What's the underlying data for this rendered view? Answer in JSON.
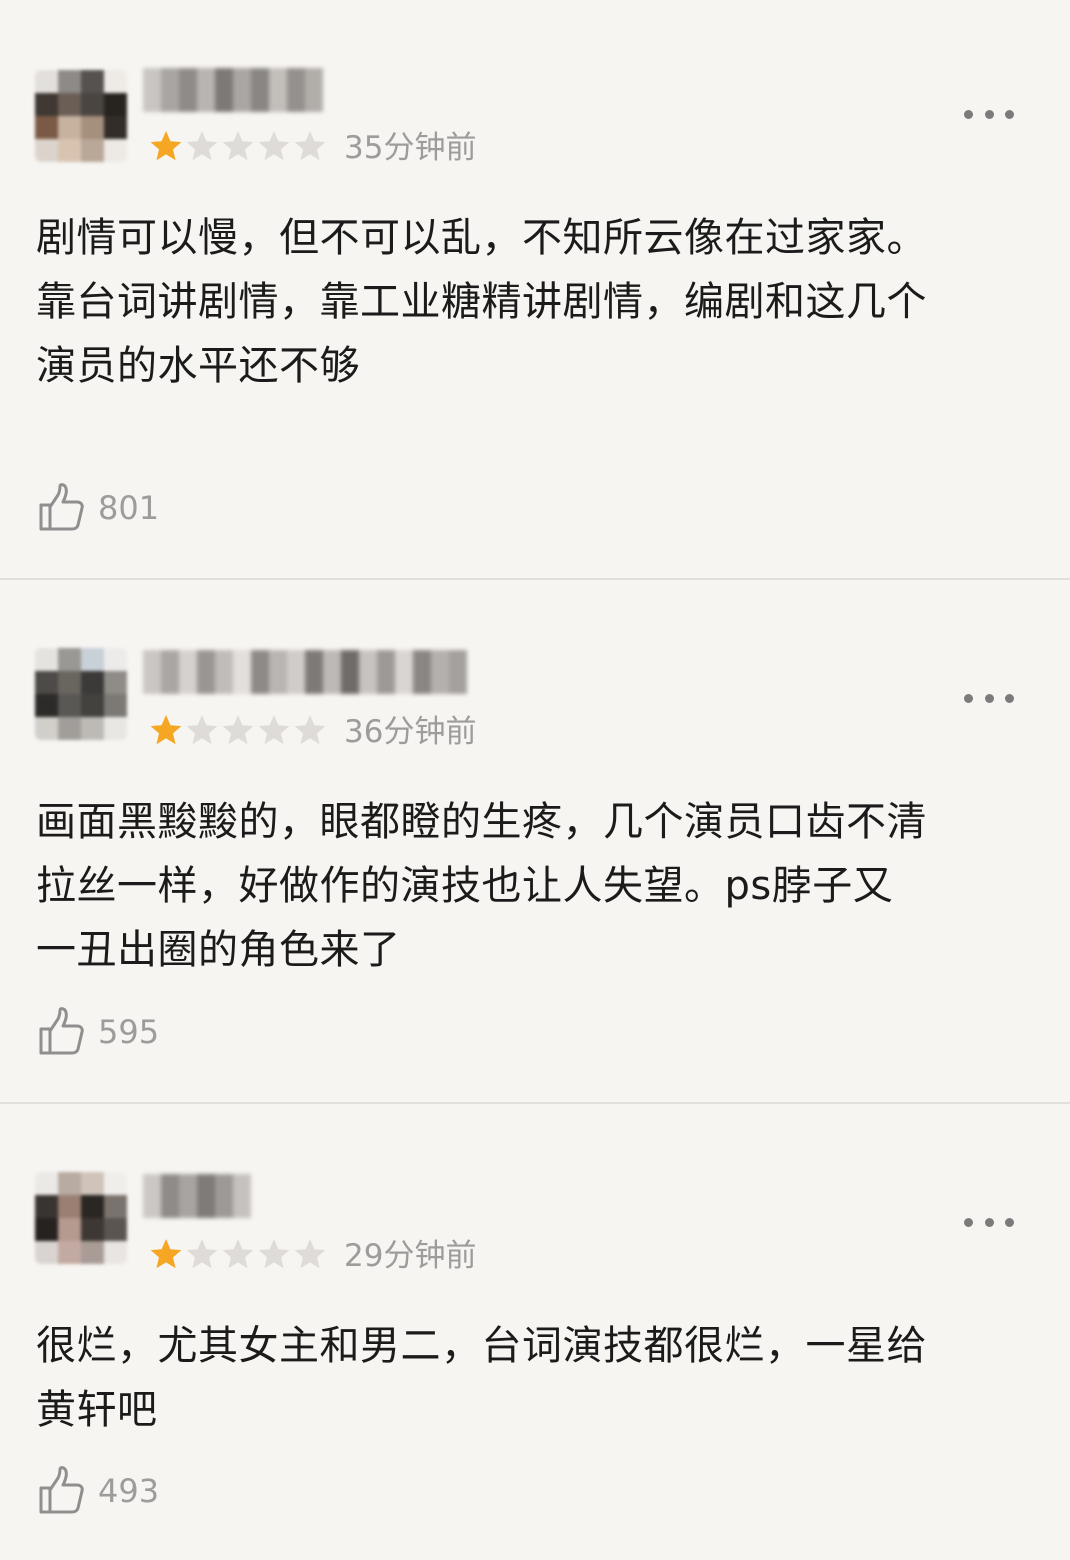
{
  "reviews": [
    {
      "time": "35分钟前",
      "rating": 1,
      "max_rating": 5,
      "content": "剧情可以慢，但不可以乱，不知所云像在过家家。\n靠台词讲剧情，靠工业糖精讲剧情，编剧和这几个\n演员的水平还不够",
      "likes": "801"
    },
    {
      "time": "36分钟前",
      "rating": 1,
      "max_rating": 5,
      "content": "画面黑黢黢的，眼都瞪的生疼，几个演员口齿不清\n拉丝一样，好做作的演技也让人失望。ps脖子又\n一丑出圈的角色来了",
      "likes": "595"
    },
    {
      "time": "29分钟前",
      "rating": 1,
      "max_rating": 5,
      "content": "很烂，尤其女主和男二，台词演技都很烂，一星给\n黄轩吧",
      "likes": "493"
    }
  ],
  "colors": {
    "background": "#f7f5f2",
    "star_filled": "#f5a623",
    "star_empty": "#dedbd8",
    "meta_text": "#9c9c9c",
    "divider": "#e2e0dd"
  },
  "icons": {
    "like": "thumbs-up-icon",
    "more": "more-dots-icon",
    "star": "star-icon"
  }
}
